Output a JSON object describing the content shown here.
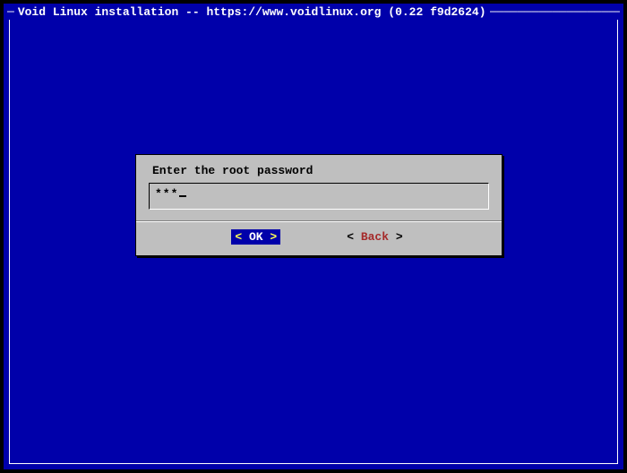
{
  "header": {
    "title": "Void Linux installation -- https://www.voidlinux.org (0.22 f9d2624)"
  },
  "dialog": {
    "prompt": "Enter the root password",
    "input_masked": "***",
    "ok_label": "OK",
    "ok_left": "<",
    "ok_right": ">",
    "back_left": "<",
    "back_right": ">",
    "back_hotkey": "B",
    "back_rest": "ack"
  }
}
